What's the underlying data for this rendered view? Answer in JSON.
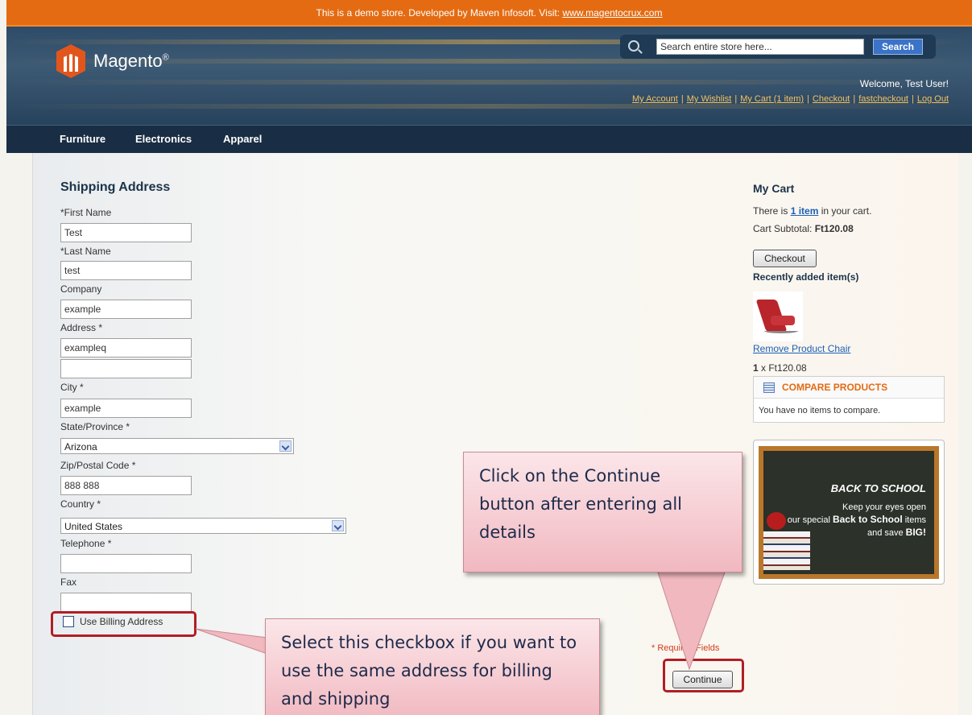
{
  "notice": {
    "text": "This is a demo store. Developed by Maven Infosoft. Visit: ",
    "link": "www.magentocrux.com"
  },
  "header": {
    "logo_text": "Magento",
    "logo_mark": "®",
    "search": {
      "placeholder": "Search entire store here...",
      "value": "Search entire store here...",
      "button": "Search"
    },
    "welcome": "Welcome, Test User!",
    "links": [
      "My Account",
      "My Wishlist",
      "My Cart (1 item)",
      "Checkout",
      "fastcheckout",
      "Log Out"
    ]
  },
  "nav": [
    "Furniture",
    "Electronics",
    "Apparel"
  ],
  "form": {
    "title": "Shipping Address",
    "first_name_label": "*First Name",
    "first_name": "Test",
    "last_name_label": "*Last Name",
    "last_name": "test",
    "company_label": "Company",
    "company": "example",
    "address_label": "Address *",
    "address1": "exampleq",
    "address2": "",
    "city_label": "City *",
    "city": "example",
    "state_label": "State/Province *",
    "state": "Arizona",
    "zip_label": "Zip/Postal Code *",
    "zip": "888 888",
    "country_label": "Country *",
    "country": "United States",
    "telephone_label": "Telephone *",
    "telephone": "",
    "fax_label": "Fax",
    "fax": "",
    "use_billing_label": "Use Billing Address",
    "use_billing_checked": false,
    "required_note": "* Required Fields",
    "continue_label": "Continue"
  },
  "cart": {
    "title": "My Cart",
    "count_prefix": "There is ",
    "count_link": "1 item",
    "count_suffix": " in your cart.",
    "subtotal_label": "Cart Subtotal: ",
    "subtotal": "Ft120.08",
    "checkout_label": "Checkout",
    "recent_title": "Recently added item(s)",
    "remove_label": "Remove Product",
    "product_name": "Chair",
    "qty_prefix": "1",
    "qty_suffix": " x Ft120.08"
  },
  "compare": {
    "title": "COMPARE PRODUCTS",
    "empty": "You have no items to compare."
  },
  "promo": {
    "title": "BACK TO SCHOOL",
    "line1": "Keep your eyes open",
    "line2": "for our special ",
    "bold": "Back to School",
    "line3": " items",
    "line4": "and save ",
    "bold2": "BIG!"
  },
  "callouts": {
    "continue": "Click on the Continue button after entering all details",
    "checkbox": "Select this checkbox if you want to use the same address for billing and shipping"
  },
  "colors": {
    "notice_bar": "#e46b12",
    "header": "#2e4b67",
    "nav": "#192e44",
    "highlight_border": "#b21d23",
    "callout_fill": "#f1b8c0",
    "link": "#1d5fb5",
    "top_links": "#f5c15a"
  }
}
